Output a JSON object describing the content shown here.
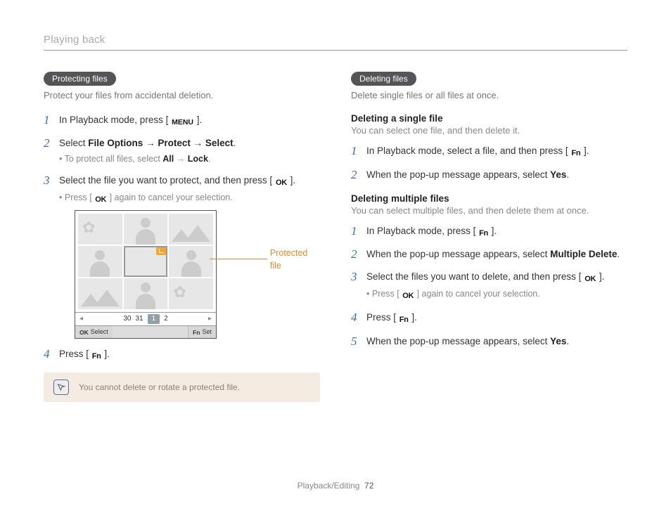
{
  "header": {
    "title": "Playing back"
  },
  "left": {
    "pill": "Protecting files",
    "intro": "Protect your files from accidental deletion.",
    "steps": {
      "s1a": "In Playback mode, press [ ",
      "s1b": " ].",
      "s2a": "Select ",
      "s2b": "File Options",
      "s2c": " → ",
      "s2d": "Protect",
      "s2e": " → ",
      "s2f": "Select",
      "s2g": ".",
      "s2sub_a": "To protect all files, select ",
      "s2sub_b": "All",
      "s2sub_c": " → ",
      "s2sub_d": "Lock",
      "s2sub_e": ".",
      "s3a": "Select the file you want to protect, and then press [ ",
      "s3b": " ].",
      "s3sub_a": "Press [ ",
      "s3sub_b": " ] again to cancel your selection.",
      "s4a": "Press [ ",
      "s4b": " ]."
    },
    "illus": {
      "callout": "Protected file",
      "cal_days": [
        "30",
        "31",
        "1",
        "2"
      ],
      "bar_ok": "OK",
      "bar_select": "Select",
      "bar_fn": "Fn",
      "bar_set": "Set"
    },
    "note": "You cannot delete or rotate a protected file."
  },
  "right": {
    "pill": "Deleting files",
    "intro": "Delete single files or all files at once.",
    "single_head": "Deleting a single file",
    "single_desc": "You can select one file, and then delete it.",
    "single_steps": {
      "s1a": "In Playback mode, select a file, and then press [ ",
      "s1b": " ].",
      "s2a": "When the pop-up message appears, select ",
      "s2b": "Yes",
      "s2c": "."
    },
    "multi_head": "Deleting multiple files",
    "multi_desc": "You can select multiple files, and then delete them at once.",
    "multi_steps": {
      "s1a": "In Playback mode, press [ ",
      "s1b": " ].",
      "s2a": "When the pop-up message appears, select ",
      "s2b": "Multiple Delete",
      "s2c": ".",
      "s3a": "Select the files you want to delete, and then press [ ",
      "s3b": " ].",
      "s3sub_a": "Press [ ",
      "s3sub_b": " ] again to cancel your selection.",
      "s4a": "Press [ ",
      "s4b": " ].",
      "s5a": "When the pop-up message appears, select ",
      "s5b": "Yes",
      "s5c": "."
    }
  },
  "icons": {
    "menu": "MENU",
    "ok": "OK",
    "fn": "Fn"
  },
  "footer": {
    "section": "Playback/Editing",
    "page": "72"
  }
}
